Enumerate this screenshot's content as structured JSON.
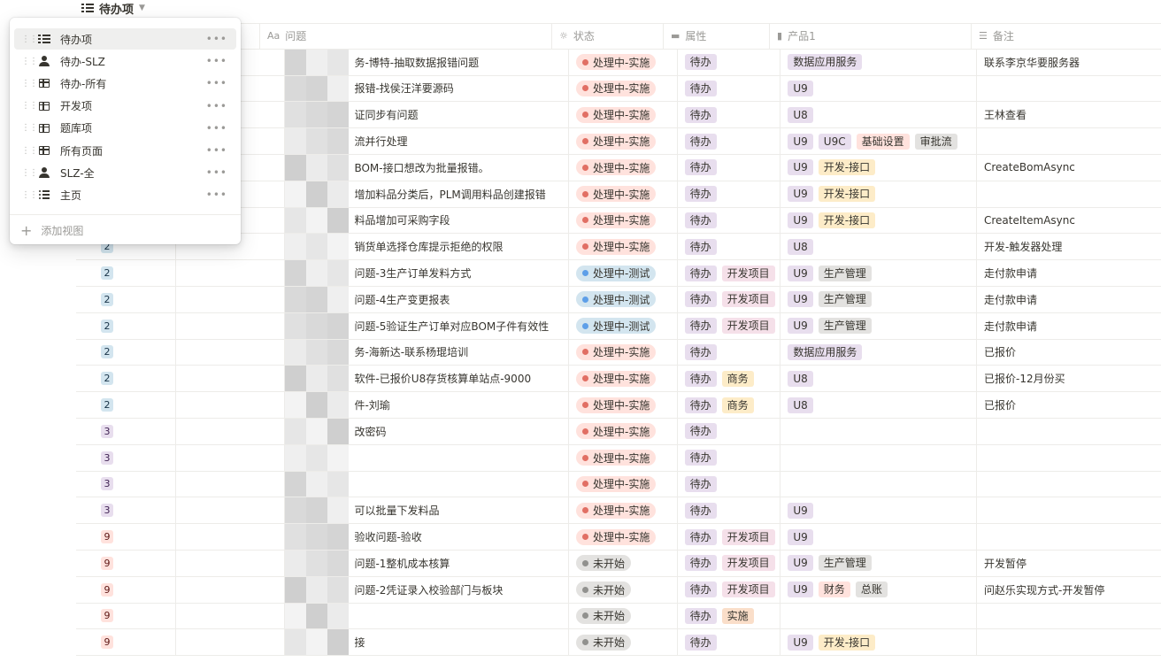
{
  "colors": {
    "status_implementing_bg": "#ffe2dd",
    "status_implementing_dot": "#e16f64",
    "status_testing_bg": "#d3e5ef",
    "status_testing_dot": "#5e9fe8",
    "status_notstarted_bg": "#e3e2e0",
    "status_notstarted_dot": "#91918e",
    "tag_purple": "#e8deee",
    "tag_pink": "#f5e0e9",
    "tag_red": "#ffe2dd",
    "tag_yellow": "#fdecc8",
    "tag_gray": "#e3e2e0",
    "tag_orange": "#fadec9"
  },
  "database": {
    "title": "待办项",
    "icon": "checklist-icon"
  },
  "view_menu": {
    "items": [
      {
        "label": "待办项",
        "icon": "checklist-icon",
        "active": true
      },
      {
        "label": "待办-SLZ",
        "icon": "person-icon"
      },
      {
        "label": "待办-所有",
        "icon": "table-icon"
      },
      {
        "label": "开发项",
        "icon": "table-icon"
      },
      {
        "label": "题库项",
        "icon": "table-icon"
      },
      {
        "label": "所有页面",
        "icon": "table-icon"
      },
      {
        "label": "SLZ-全",
        "icon": "person-icon"
      },
      {
        "label": "主页",
        "icon": "list-icon"
      }
    ],
    "more_label": "•••",
    "add_view_label": "添加视图"
  },
  "columns": [
    {
      "label": "",
      "icon": ""
    },
    {
      "label": "",
      "icon": ""
    },
    {
      "label": "问题",
      "icon": "Aa"
    },
    {
      "label": "状态",
      "icon": "status-icon"
    },
    {
      "label": "属性",
      "icon": "folder-icon"
    },
    {
      "label": "产品1",
      "icon": "book-icon"
    },
    {
      "label": "备注",
      "icon": "text-icon"
    }
  ],
  "header_icons": {
    "issue": "Aa",
    "status": "☼",
    "attr": "▬",
    "product": "▮",
    "note": "☰"
  },
  "rows": [
    {
      "num": "",
      "issue": "务-博特-抽取数据报错问题",
      "status": "处理中-实施",
      "attrs": [
        "待办"
      ],
      "products": [
        "数据应用服务"
      ],
      "note": "联系李京华要服务器"
    },
    {
      "num": "",
      "issue": "报错-找侯汪洋要源码",
      "status": "处理中-实施",
      "attrs": [
        "待办"
      ],
      "products": [
        "U9"
      ],
      "note": ""
    },
    {
      "num": "",
      "issue": "证同步有问题",
      "status": "处理中-实施",
      "attrs": [
        "待办"
      ],
      "products": [
        "U8"
      ],
      "note": "王林查看"
    },
    {
      "num": "",
      "issue": "流并行处理",
      "status": "处理中-实施",
      "attrs": [
        "待办"
      ],
      "products": [
        "U9",
        "U9C",
        "基础设置",
        "审批流"
      ],
      "note": ""
    },
    {
      "num": "",
      "issue": "BOM-接口想改为批量报错。",
      "status": "处理中-实施",
      "attrs": [
        "待办"
      ],
      "products": [
        "U9",
        "开发-接口"
      ],
      "note": "CreateBomAsync"
    },
    {
      "num": "",
      "issue": "增加料品分类后，PLM调用料品创建报错",
      "status": "处理中-实施",
      "attrs": [
        "待办"
      ],
      "products": [
        "U9",
        "开发-接口"
      ],
      "note": ""
    },
    {
      "num": "",
      "issue": "料品增加可采购字段",
      "status": "处理中-实施",
      "attrs": [
        "待办"
      ],
      "products": [
        "U9",
        "开发-接口"
      ],
      "note": "CreateItemAsync"
    },
    {
      "num": "2",
      "issue": "销货单选择仓库提示拒绝的权限",
      "status": "处理中-实施",
      "attrs": [
        "待办"
      ],
      "products": [
        "U8"
      ],
      "note": "开发-触发器处理"
    },
    {
      "num": "2",
      "issue": "问题-3生产订单发料方式",
      "status": "处理中-测试",
      "attrs": [
        "待办",
        "开发项目"
      ],
      "products": [
        "U9",
        "生产管理"
      ],
      "note": "走付款申请"
    },
    {
      "num": "2",
      "issue": "问题-4生产变更报表",
      "status": "处理中-测试",
      "attrs": [
        "待办",
        "开发项目"
      ],
      "products": [
        "U9",
        "生产管理"
      ],
      "note": "走付款申请"
    },
    {
      "num": "2",
      "issue": "问题-5验证生产订单对应BOM子件有效性",
      "status": "处理中-测试",
      "attrs": [
        "待办",
        "开发项目"
      ],
      "products": [
        "U9",
        "生产管理"
      ],
      "note": "走付款申请"
    },
    {
      "num": "2",
      "issue": "务-海新达-联系杨琨培训",
      "status": "处理中-实施",
      "attrs": [
        "待办"
      ],
      "products": [
        "数据应用服务"
      ],
      "note": "已报价"
    },
    {
      "num": "2",
      "issue": "软件-已报价U8存货核算单站点-9000",
      "status": "处理中-实施",
      "attrs": [
        "待办",
        "商务"
      ],
      "products": [
        "U8"
      ],
      "note": "已报价-12月份买"
    },
    {
      "num": "2",
      "issue": "件-刘瑜",
      "status": "处理中-实施",
      "attrs": [
        "待办",
        "商务"
      ],
      "products": [
        "U8"
      ],
      "note": "已报价"
    },
    {
      "num": "3",
      "issue": "改密码",
      "status": "处理中-实施",
      "attrs": [
        "待办"
      ],
      "products": [],
      "note": ""
    },
    {
      "num": "3",
      "issue": "",
      "status": "处理中-实施",
      "attrs": [
        "待办"
      ],
      "products": [],
      "note": ""
    },
    {
      "num": "3",
      "issue": "",
      "status": "处理中-实施",
      "attrs": [
        "待办"
      ],
      "products": [],
      "note": ""
    },
    {
      "num": "3",
      "issue": "可以批量下发料品",
      "status": "处理中-实施",
      "attrs": [
        "待办"
      ],
      "products": [
        "U9"
      ],
      "note": ""
    },
    {
      "num": "9",
      "issue": "验收问题-验收",
      "status": "处理中-实施",
      "attrs": [
        "待办",
        "开发项目"
      ],
      "products": [
        "U9"
      ],
      "note": ""
    },
    {
      "num": "9",
      "issue": "问题-1整机成本核算",
      "status": "未开始",
      "attrs": [
        "待办",
        "开发项目"
      ],
      "products": [
        "U9",
        "生产管理"
      ],
      "note": "开发暂停"
    },
    {
      "num": "9",
      "issue": "问题-2凭证录入校验部门与板块",
      "status": "未开始",
      "attrs": [
        "待办",
        "开发项目"
      ],
      "products": [
        "U9",
        "财务",
        "总账"
      ],
      "note": "问赵乐实现方式-开发暂停"
    },
    {
      "num": "9",
      "issue": "",
      "status": "未开始",
      "attrs": [
        "待办",
        "实施"
      ],
      "products": [],
      "note": ""
    },
    {
      "num": "9",
      "issue": "接",
      "status": "未开始",
      "attrs": [
        "待办"
      ],
      "products": [
        "U9",
        "开发-接口"
      ],
      "note": ""
    }
  ]
}
